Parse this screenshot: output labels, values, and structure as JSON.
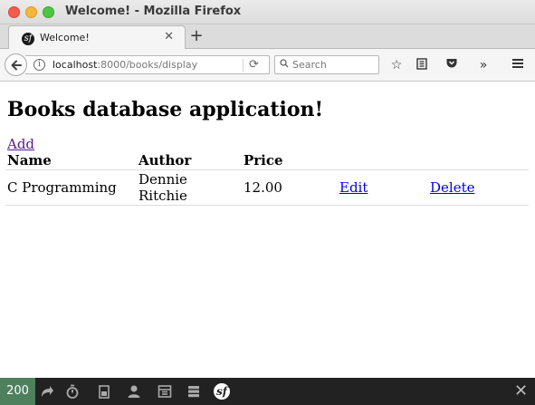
{
  "window": {
    "title": "Welcome! - Mozilla Firefox"
  },
  "tab": {
    "label": "Welcome!",
    "favicon_glyph": "sf",
    "close_glyph": "✕",
    "newtab_glyph": "+"
  },
  "navbar": {
    "url_host": "localhost",
    "url_path": ":8000/books/display",
    "search_placeholder": "Search",
    "reload_glyph": "⟳",
    "info_glyph": "i"
  },
  "page": {
    "title": "Books database application!",
    "add_link": "Add",
    "table": {
      "headers": [
        "Name",
        "Author",
        "Price",
        "",
        ""
      ],
      "rows": [
        {
          "name": "C Programming",
          "author": "Dennie Ritchie",
          "price": "12.00",
          "edit": "Edit",
          "delete": "Delete"
        }
      ]
    }
  },
  "debug_toolbar": {
    "status": "200",
    "close_glyph": "✕",
    "logo_glyph": "sf"
  },
  "colors": {
    "link_visited": "#551a8b",
    "link": "#0000ee",
    "status_ok": "#4f805d",
    "toolbar_bg": "#222222"
  }
}
